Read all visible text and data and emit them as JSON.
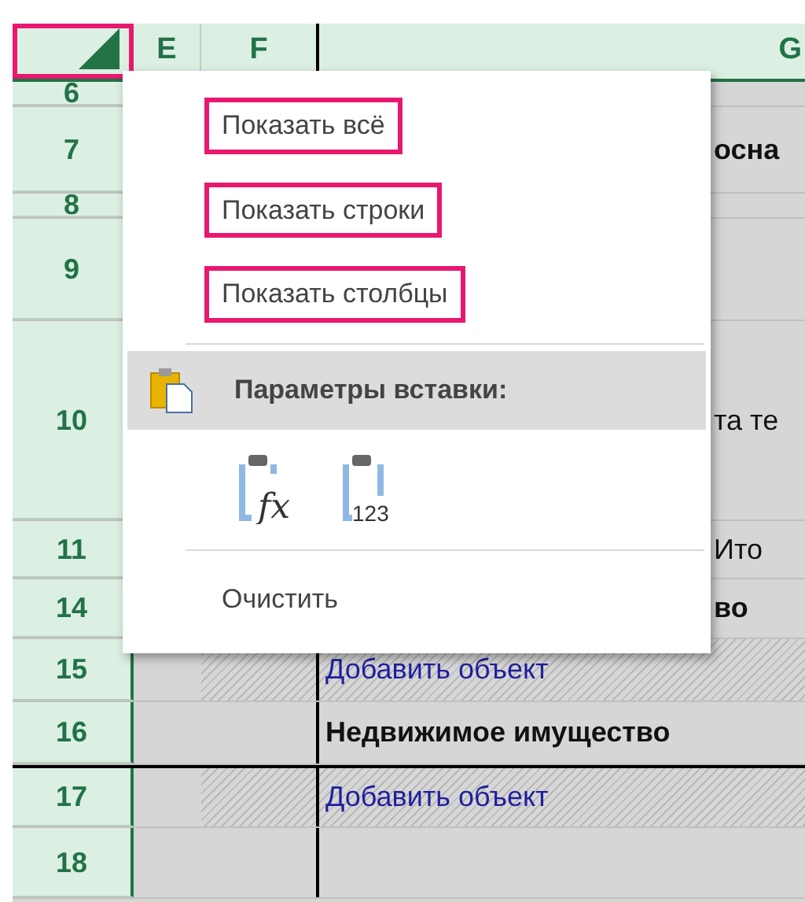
{
  "corner": {
    "highlighted": true
  },
  "columns": [
    "E",
    "F",
    "G"
  ],
  "rows": [
    {
      "number": "6",
      "kind": "text"
    },
    {
      "number": "7",
      "kind": "heading",
      "text": "осна"
    },
    {
      "number": "8",
      "kind": "text"
    },
    {
      "number": "9",
      "kind": "text"
    },
    {
      "number": "10",
      "kind": "text",
      "text": "та те"
    },
    {
      "number": "11",
      "kind": "text",
      "text": "Ито"
    },
    {
      "number": "14",
      "kind": "heading",
      "text": "во"
    },
    {
      "number": "15",
      "kind": "link",
      "text": "Добавить объект"
    },
    {
      "number": "16",
      "kind": "heading",
      "text": "Недвижимое имущество"
    },
    {
      "number": "17",
      "kind": "link",
      "text": "Добавить объект"
    },
    {
      "number": "18",
      "kind": "text"
    }
  ],
  "context_menu": [
    {
      "kind": "item",
      "label": "Показать всё",
      "highlighted": true
    },
    {
      "kind": "item",
      "label": "Показать строки",
      "highlighted": true
    },
    {
      "kind": "item",
      "label": "Показать столбцы",
      "highlighted": true
    },
    {
      "kind": "divider"
    },
    {
      "kind": "section",
      "label": "Параметры вставки:"
    },
    {
      "kind": "paste-options",
      "options": [
        "fx",
        "123"
      ]
    },
    {
      "kind": "divider"
    },
    {
      "kind": "item",
      "label": "Очистить",
      "highlighted": false
    }
  ]
}
